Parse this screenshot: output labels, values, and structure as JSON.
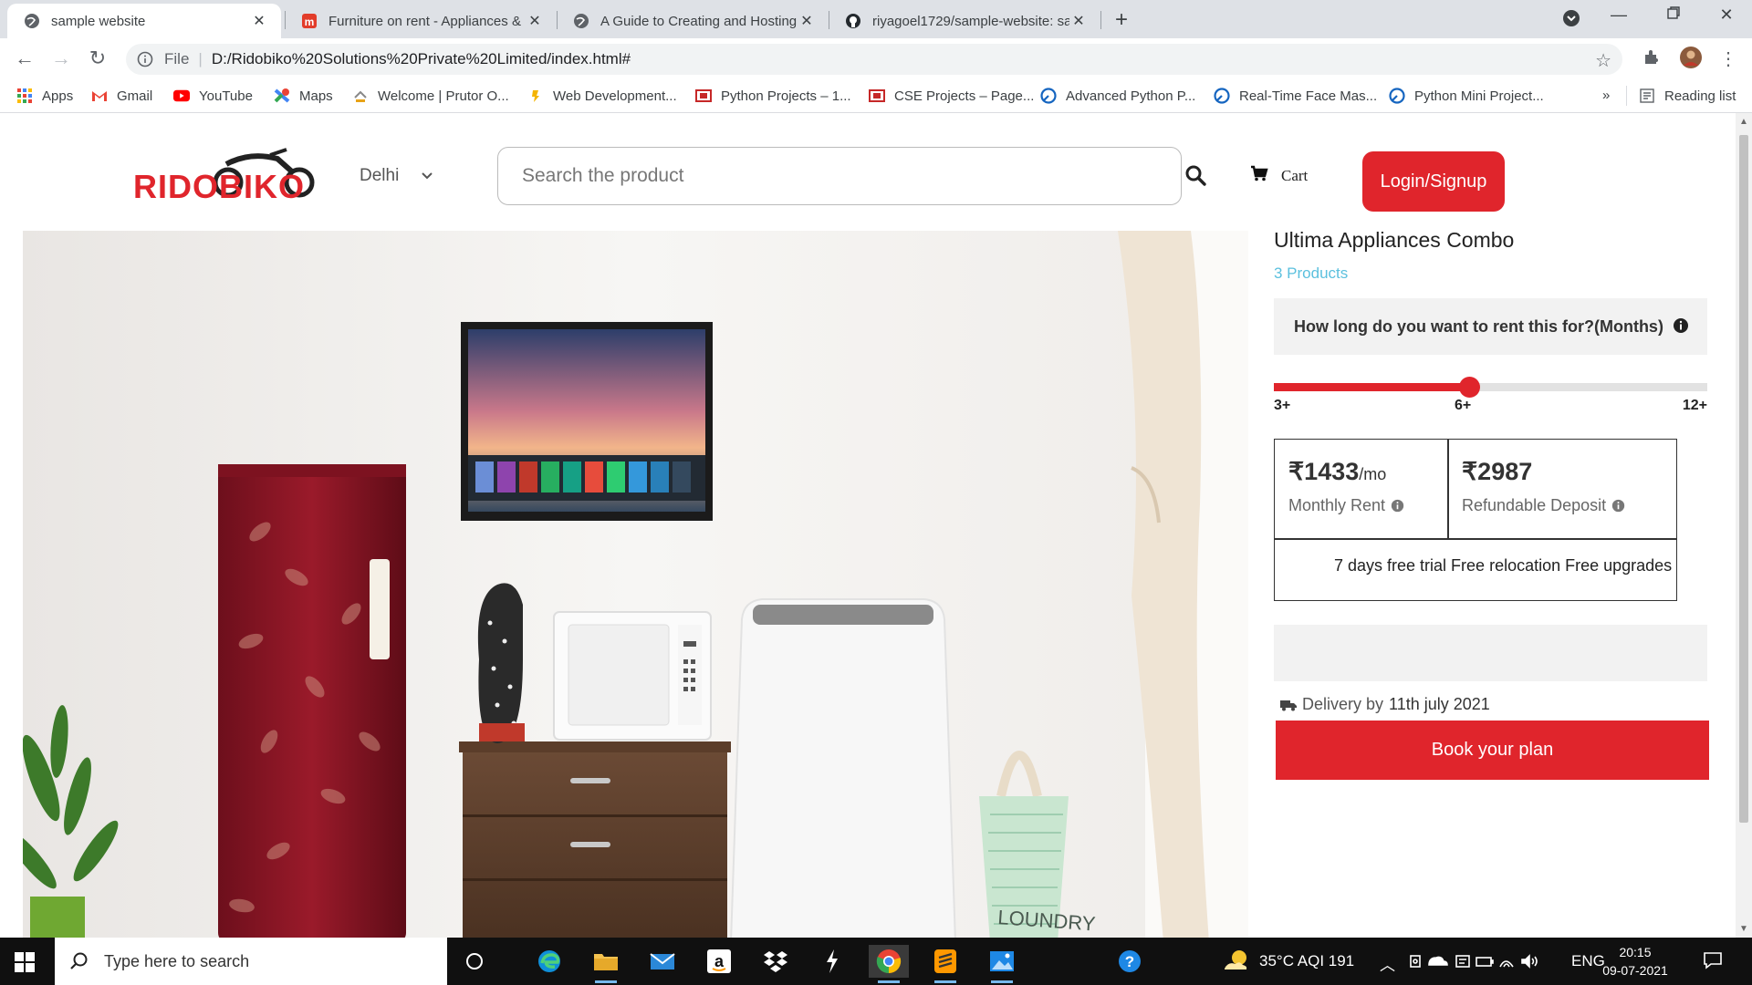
{
  "browser": {
    "tabs": [
      {
        "title": "sample website",
        "icon": "globe-icon",
        "active": true
      },
      {
        "title": "Furniture on rent - Appliances &",
        "icon": "furlenco-icon",
        "active": false
      },
      {
        "title": "A Guide to Creating and Hosting",
        "icon": "globe-icon",
        "active": false
      },
      {
        "title": "riyagoel1729/sample-website: sa",
        "icon": "github-icon",
        "active": false
      }
    ],
    "address": {
      "protocol": "File",
      "url": "D:/Ridobiko%20Solutions%20Private%20Limited/index.html#"
    },
    "bookmarks": [
      {
        "label": "Apps",
        "icon": "apps-grid-icon"
      },
      {
        "label": "Gmail",
        "icon": "gmail-icon"
      },
      {
        "label": "YouTube",
        "icon": "youtube-icon"
      },
      {
        "label": "Maps",
        "icon": "maps-icon"
      },
      {
        "label": "Welcome | Prutor O...",
        "icon": "prutor-icon"
      },
      {
        "label": "Web Development...",
        "icon": "web-dev-icon"
      },
      {
        "label": "Python Projects – 1...",
        "icon": "python-projects-icon"
      },
      {
        "label": "CSE Projects – Page...",
        "icon": "cse-projects-icon"
      },
      {
        "label": "Advanced Python P...",
        "icon": "advanced-python-icon"
      },
      {
        "label": "Real-Time Face Mas...",
        "icon": "face-mask-icon"
      },
      {
        "label": "Python Mini Project...",
        "icon": "python-mini-icon"
      }
    ],
    "bookmarks_overflow": "»",
    "reading_list": "Reading list"
  },
  "site": {
    "logo_text": "RIDOBIKO",
    "city": "Delhi",
    "search_placeholder": "Search the product",
    "cart_label": "Cart",
    "login_label": "Login/Signup",
    "colors": {
      "brand_red": "#e0252c",
      "link_blue": "#5bc0de"
    }
  },
  "product": {
    "title": "Ultima Appliances Combo",
    "count_label": "3 Products",
    "rent_question": "How long do you want to rent this for?(Months)",
    "tenure": {
      "options": [
        "3+",
        "6+",
        "12+"
      ],
      "selected": "6+",
      "selected_fraction": 0.45
    },
    "monthly_rent": {
      "value": "₹1433",
      "unit": "/mo",
      "label": "Monthly Rent"
    },
    "deposit": {
      "value": "₹2987",
      "label": "Refundable Deposit"
    },
    "perks": "7 days free trial Free relocation Free upgrades",
    "delivery_label": "Delivery by",
    "delivery_date": "11th july 2021",
    "book_label": "Book your plan"
  },
  "taskbar": {
    "search_placeholder": "Type here to search",
    "weather": "35°C  AQI 191",
    "language": "ENG",
    "time": "20:15",
    "date": "09-07-2021"
  }
}
